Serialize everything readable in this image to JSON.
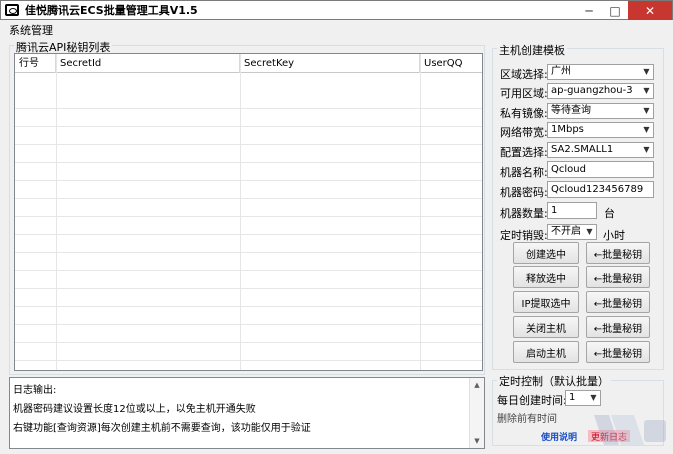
{
  "window": {
    "title": "佳悦腾讯云ECS批量管理工具V1.5",
    "min_glyph": "─",
    "max_glyph": "□",
    "close_glyph": "✕"
  },
  "menu": {
    "items": [
      "系统管理"
    ]
  },
  "key_list": {
    "group_title": "腾讯云API秘钥列表",
    "columns": [
      "行号",
      "SecretId",
      "SecretKey",
      "UserQQ"
    ],
    "rows": []
  },
  "log": {
    "title": "日志输出:",
    "lines": [
      "机器密码建议设置长度12位或以上，以免主机开通失败",
      "右键功能[查询资源]每次创建主机前不需要查询，该功能仅用于验证"
    ],
    "scroll_up": "▲",
    "scroll_down": "▼"
  },
  "host_template": {
    "group_title": "主机创建模板",
    "fields": {
      "region_label": "区域选择:",
      "region_value": "广州",
      "zone_label": "可用区域:",
      "zone_value": "ap-guangzhou-3",
      "image_label": "私有镜像:",
      "image_value": "等待查询",
      "bandwidth_label": "网络带宽:",
      "bandwidth_value": "1Mbps",
      "config_label": "配置选择:",
      "config_value": "SA2.SMALL1",
      "name_label": "机器名称:",
      "name_value": "Qcloud",
      "password_label": "机器密码:",
      "password_value": "Qcloud123456789",
      "count_label": "机器数量:",
      "count_value": "1",
      "count_unit": "台",
      "timer_label": "定时销毁:",
      "timer_value": "不开启",
      "timer_unit": "小时"
    },
    "actions": [
      {
        "label": "创建选中",
        "batch": "←批量秘钥"
      },
      {
        "label": "释放选中",
        "batch": "←批量秘钥"
      },
      {
        "label": "IP提取选中",
        "batch": "←批量秘钥"
      },
      {
        "label": "关闭主机",
        "batch": "←批量秘钥"
      },
      {
        "label": "启动主机",
        "batch": "←批量秘钥"
      }
    ],
    "dropdown_arrow": "▼"
  },
  "schedule": {
    "group_title": "定时控制（默认批量）",
    "daily_label": "每日创建时间:",
    "daily_value": "1",
    "note_partial": "删除前有时间",
    "links": {
      "blue": "使用说明",
      "pink": "更新日志"
    }
  }
}
